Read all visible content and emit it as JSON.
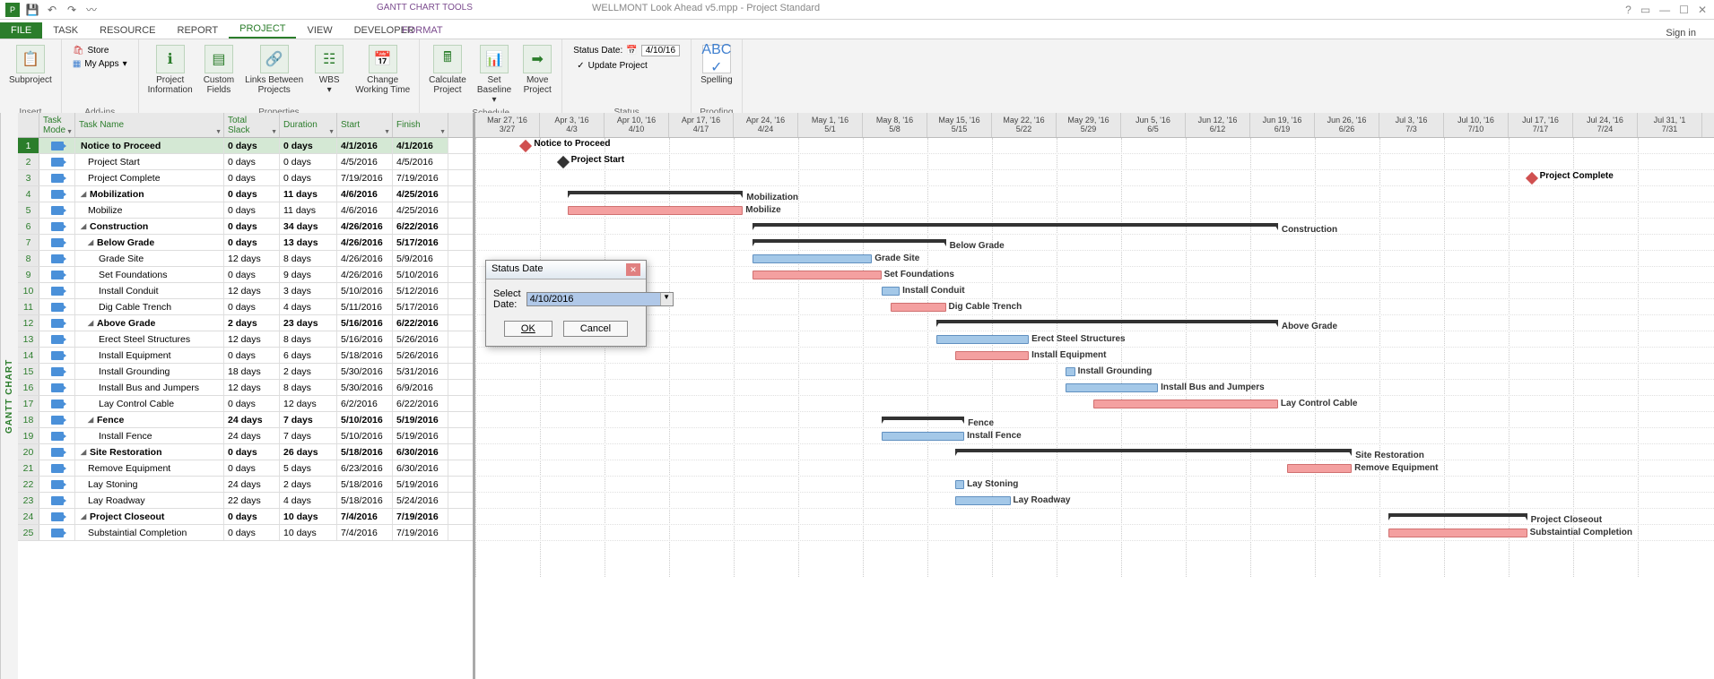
{
  "app": {
    "context_title": "GANTT CHART TOOLS",
    "file_title": "WELLMONT Look Ahead v5.mpp - Project Standard",
    "signin": "Sign in"
  },
  "tabs": {
    "file": "FILE",
    "items": [
      "TASK",
      "RESOURCE",
      "REPORT",
      "PROJECT",
      "VIEW",
      "DEVELOPER"
    ],
    "context": "FORMAT",
    "active": "PROJECT"
  },
  "ribbon": {
    "insert": {
      "label": "Insert",
      "subproject": "Subproject"
    },
    "addins": {
      "label": "Add-ins",
      "store": "Store",
      "myapps": "My Apps"
    },
    "properties": {
      "label": "Properties",
      "project_info": "Project\nInformation",
      "custom_fields": "Custom\nFields",
      "links": "Links Between\nProjects",
      "wbs": "WBS",
      "change_time": "Change\nWorking Time"
    },
    "schedule": {
      "label": "Schedule",
      "calculate": "Calculate\nProject",
      "baseline": "Set\nBaseline",
      "move": "Move\nProject"
    },
    "status": {
      "label": "Status",
      "status_date_label": "Status Date:",
      "status_date_value": "4/10/16",
      "update": "Update Project"
    },
    "proofing": {
      "label": "Proofing",
      "spelling": "Spelling"
    }
  },
  "gantt_label": "GANTT CHART",
  "columns": {
    "mode": "Task\nMode",
    "name": "Task Name",
    "slack": "Total\nSlack",
    "duration": "Duration",
    "start": "Start",
    "finish": "Finish"
  },
  "timeline_headers": [
    {
      "top": "Mar 27, '16",
      "bot": "3/27"
    },
    {
      "top": "Apr 3, '16",
      "bot": "4/3"
    },
    {
      "top": "Apr 10, '16",
      "bot": "4/10"
    },
    {
      "top": "Apr 17, '16",
      "bot": "4/17"
    },
    {
      "top": "Apr 24, '16",
      "bot": "4/24"
    },
    {
      "top": "May 1, '16",
      "bot": "5/1"
    },
    {
      "top": "May 8, '16",
      "bot": "5/8"
    },
    {
      "top": "May 15, '16",
      "bot": "5/15"
    },
    {
      "top": "May 22, '16",
      "bot": "5/22"
    },
    {
      "top": "May 29, '16",
      "bot": "5/29"
    },
    {
      "top": "Jun 5, '16",
      "bot": "6/5"
    },
    {
      "top": "Jun 12, '16",
      "bot": "6/12"
    },
    {
      "top": "Jun 19, '16",
      "bot": "6/19"
    },
    {
      "top": "Jun 26, '16",
      "bot": "6/26"
    },
    {
      "top": "Jul 3, '16",
      "bot": "7/3"
    },
    {
      "top": "Jul 10, '16",
      "bot": "7/10"
    },
    {
      "top": "Jul 17, '16",
      "bot": "7/17"
    },
    {
      "top": "Jul 24, '16",
      "bot": "7/24"
    },
    {
      "top": "Jul 31, '1",
      "bot": "7/31"
    }
  ],
  "tasks": [
    {
      "id": 1,
      "name": "Notice to Proceed",
      "slack": "0 days",
      "dur": "0 days",
      "start": "4/1/2016",
      "finish": "4/1/2016",
      "indent": 0,
      "bold": true,
      "selected": true,
      "type": "milestone",
      "crit": true,
      "bar_start": 5,
      "bar_len": 0
    },
    {
      "id": 2,
      "name": "Project Start",
      "slack": "0 days",
      "dur": "0 days",
      "start": "4/5/2016",
      "finish": "4/5/2016",
      "indent": 1,
      "type": "milestone",
      "crit": false,
      "bar_start": 9,
      "bar_len": 0
    },
    {
      "id": 3,
      "name": "Project Complete",
      "slack": "0 days",
      "dur": "0 days",
      "start": "7/19/2016",
      "finish": "7/19/2016",
      "indent": 1,
      "type": "milestone",
      "crit": true,
      "bar_start": 114,
      "bar_len": 0
    },
    {
      "id": 4,
      "name": "Mobilization",
      "slack": "0 days",
      "dur": "11 days",
      "start": "4/6/2016",
      "finish": "4/25/2016",
      "indent": 0,
      "bold": true,
      "summary": true,
      "type": "summary",
      "bar_start": 10,
      "bar_len": 19
    },
    {
      "id": 5,
      "name": "Mobilize",
      "slack": "0 days",
      "dur": "11 days",
      "start": "4/6/2016",
      "finish": "4/25/2016",
      "indent": 1,
      "type": "task",
      "crit": true,
      "bar_start": 10,
      "bar_len": 19
    },
    {
      "id": 6,
      "name": "Construction",
      "slack": "0 days",
      "dur": "34 days",
      "start": "4/26/2016",
      "finish": "6/22/2016",
      "indent": 0,
      "bold": true,
      "summary": true,
      "type": "summary",
      "bar_start": 30,
      "bar_len": 57
    },
    {
      "id": 7,
      "name": "Below Grade",
      "slack": "0 days",
      "dur": "13 days",
      "start": "4/26/2016",
      "finish": "5/17/2016",
      "indent": 1,
      "bold": true,
      "summary": true,
      "type": "summary",
      "bar_start": 30,
      "bar_len": 21
    },
    {
      "id": 8,
      "name": "Grade Site",
      "slack": "12 days",
      "dur": "8 days",
      "start": "4/26/2016",
      "finish": "5/9/2016",
      "indent": 2,
      "type": "task",
      "crit": false,
      "bar_start": 30,
      "bar_len": 13
    },
    {
      "id": 9,
      "name": "Set Foundations",
      "slack": "0 days",
      "dur": "9 days",
      "start": "4/26/2016",
      "finish": "5/10/2016",
      "indent": 2,
      "type": "task",
      "crit": true,
      "bar_start": 30,
      "bar_len": 14
    },
    {
      "id": 10,
      "name": "Install Conduit",
      "slack": "12 days",
      "dur": "3 days",
      "start": "5/10/2016",
      "finish": "5/12/2016",
      "indent": 2,
      "type": "task",
      "crit": false,
      "bar_start": 44,
      "bar_len": 2
    },
    {
      "id": 11,
      "name": "Dig Cable Trench",
      "slack": "0 days",
      "dur": "4 days",
      "start": "5/11/2016",
      "finish": "5/17/2016",
      "indent": 2,
      "type": "task",
      "crit": true,
      "bar_start": 45,
      "bar_len": 6
    },
    {
      "id": 12,
      "name": "Above Grade",
      "slack": "2 days",
      "dur": "23 days",
      "start": "5/16/2016",
      "finish": "6/22/2016",
      "indent": 1,
      "bold": true,
      "summary": true,
      "type": "summary",
      "bar_start": 50,
      "bar_len": 37
    },
    {
      "id": 13,
      "name": "Erect Steel Structures",
      "slack": "12 days",
      "dur": "8 days",
      "start": "5/16/2016",
      "finish": "5/26/2016",
      "indent": 2,
      "type": "task",
      "crit": false,
      "bar_start": 50,
      "bar_len": 10
    },
    {
      "id": 14,
      "name": "Install Equipment",
      "slack": "0 days",
      "dur": "6 days",
      "start": "5/18/2016",
      "finish": "5/26/2016",
      "indent": 2,
      "type": "task",
      "crit": true,
      "bar_start": 52,
      "bar_len": 8
    },
    {
      "id": 15,
      "name": "Install Grounding",
      "slack": "18 days",
      "dur": "2 days",
      "start": "5/30/2016",
      "finish": "5/31/2016",
      "indent": 2,
      "type": "task",
      "crit": false,
      "bar_start": 64,
      "bar_len": 1
    },
    {
      "id": 16,
      "name": "Install Bus and Jumpers",
      "slack": "12 days",
      "dur": "8 days",
      "start": "5/30/2016",
      "finish": "6/9/2016",
      "indent": 2,
      "type": "task",
      "crit": false,
      "bar_start": 64,
      "bar_len": 10
    },
    {
      "id": 17,
      "name": "Lay Control Cable",
      "slack": "0 days",
      "dur": "12 days",
      "start": "6/2/2016",
      "finish": "6/22/2016",
      "indent": 2,
      "type": "task",
      "crit": true,
      "bar_start": 67,
      "bar_len": 20
    },
    {
      "id": 18,
      "name": "Fence",
      "slack": "24 days",
      "dur": "7 days",
      "start": "5/10/2016",
      "finish": "5/19/2016",
      "indent": 1,
      "bold": true,
      "summary": true,
      "type": "summary",
      "bar_start": 44,
      "bar_len": 9
    },
    {
      "id": 19,
      "name": "Install Fence",
      "slack": "24 days",
      "dur": "7 days",
      "start": "5/10/2016",
      "finish": "5/19/2016",
      "indent": 2,
      "type": "task",
      "crit": false,
      "bar_start": 44,
      "bar_len": 9
    },
    {
      "id": 20,
      "name": "Site Restoration",
      "slack": "0 days",
      "dur": "26 days",
      "start": "5/18/2016",
      "finish": "6/30/2016",
      "indent": 0,
      "bold": true,
      "summary": true,
      "type": "summary",
      "bar_start": 52,
      "bar_len": 43
    },
    {
      "id": 21,
      "name": "Remove Equipment",
      "slack": "0 days",
      "dur": "5 days",
      "start": "6/23/2016",
      "finish": "6/30/2016",
      "indent": 1,
      "type": "task",
      "crit": true,
      "bar_start": 88,
      "bar_len": 7
    },
    {
      "id": 22,
      "name": "Lay Stoning",
      "slack": "24 days",
      "dur": "2 days",
      "start": "5/18/2016",
      "finish": "5/19/2016",
      "indent": 1,
      "type": "task",
      "crit": false,
      "bar_start": 52,
      "bar_len": 1
    },
    {
      "id": 23,
      "name": "Lay Roadway",
      "slack": "22 days",
      "dur": "4 days",
      "start": "5/18/2016",
      "finish": "5/24/2016",
      "indent": 1,
      "type": "task",
      "crit": false,
      "bar_start": 52,
      "bar_len": 6
    },
    {
      "id": 24,
      "name": "Project Closeout",
      "slack": "0 days",
      "dur": "10 days",
      "start": "7/4/2016",
      "finish": "7/19/2016",
      "indent": 0,
      "bold": true,
      "summary": true,
      "type": "summary",
      "bar_start": 99,
      "bar_len": 15
    },
    {
      "id": 25,
      "name": "Substaintial Completion",
      "slack": "0 days",
      "dur": "10 days",
      "start": "7/4/2016",
      "finish": "7/19/2016",
      "indent": 1,
      "type": "task",
      "crit": true,
      "bar_start": 99,
      "bar_len": 15
    }
  ],
  "dialog": {
    "title": "Status Date",
    "label": "Select Date:",
    "value": "4/10/2016",
    "ok": "OK",
    "cancel": "Cancel"
  },
  "chart_data": {
    "type": "gantt",
    "date_range": [
      "2016-03-27",
      "2016-07-31"
    ],
    "status_date": "2016-04-10",
    "tasks_ref": "see tasks[] array: bar_start = day offset from 3/27, bar_len = duration days"
  }
}
